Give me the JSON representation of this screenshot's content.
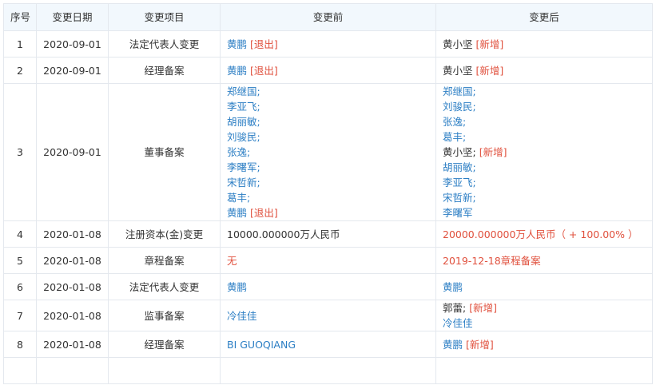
{
  "headers": {
    "idx": "序号",
    "date": "变更日期",
    "item": "变更项目",
    "before": "变更前",
    "after": "变更后"
  },
  "tags": {
    "exit": "[退出]",
    "new": "[新增]"
  },
  "rows": [
    {
      "idx": "1",
      "date": "2020-09-01",
      "item": "法定代表人变更",
      "before": [
        {
          "name": "黄鹏"
        }
      ],
      "after": [
        {
          "name": "黄小坚"
        }
      ]
    },
    {
      "idx": "2",
      "date": "2020-09-01",
      "item": "经理备案",
      "before": [
        {
          "name": "黄鹏"
        }
      ],
      "after": [
        {
          "name": "黄小坚"
        }
      ]
    },
    {
      "idx": "3",
      "date": "2020-09-01",
      "item": "董事备案",
      "before": [
        "郑继国;",
        "李亚飞;",
        "胡丽敏;",
        "刘骏民;",
        "张逸;",
        "李曙军;",
        "宋哲新;",
        "葛丰;",
        "黄鹏"
      ],
      "after": [
        "郑继国;",
        "刘骏民;",
        "张逸;",
        "葛丰;",
        "黄小坚;",
        "胡丽敏;",
        "李亚飞;",
        "宋哲新;",
        "李曙军"
      ]
    },
    {
      "idx": "4",
      "date": "2020-01-08",
      "item": "注册资本(金)变更",
      "before": "10000.000000万人民币",
      "after": "20000.000000万人民币（ + 100.00% ）"
    },
    {
      "idx": "5",
      "date": "2020-01-08",
      "item": "章程备案",
      "before": "无",
      "after": "2019-12-18章程备案"
    },
    {
      "idx": "6",
      "date": "2020-01-08",
      "item": "法定代表人变更",
      "before": "黄鹏",
      "after": "黄鹏"
    },
    {
      "idx": "7",
      "date": "2020-01-08",
      "item": "监事备案",
      "before": "冷佳佳",
      "after": [
        "郭蕾;",
        "冷佳佳"
      ]
    },
    {
      "idx": "8",
      "date": "2020-01-08",
      "item": "经理备案",
      "before": "BI GUOQIANG",
      "after": "黄鹏"
    }
  ],
  "colors": {
    "link": "#2b7ec4",
    "tag": "#e0503d",
    "header_bg": "#f2f8fd",
    "border": "#e4e8ee"
  }
}
